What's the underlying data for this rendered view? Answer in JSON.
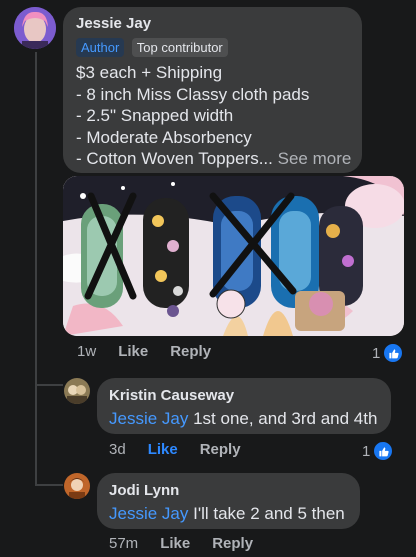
{
  "comments": [
    {
      "author": "Jessie Jay",
      "badges": [
        "Author",
        "Top contributor"
      ],
      "lines": [
        "$3 each + Shipping",
        "- 8 inch Miss Classy cloth pads",
        "- 2.5\" Snapped width",
        "- Moderate Absorbency",
        "- Cotton Woven Toppers..."
      ],
      "see_more": "See more",
      "time": "1w",
      "like_label": "Like",
      "reply_label": "Reply",
      "reaction_count": "1"
    },
    {
      "author": "Kristin Causeway",
      "mention": "Jessie Jay",
      "text": " 1st one, and 3rd and 4th",
      "time": "3d",
      "like_label": "Like",
      "reply_label": "Reply",
      "reaction_count": "1"
    },
    {
      "author": "Jodi Lynn",
      "mention": "Jessie Jay",
      "text": " I'll take 2 and 5 then",
      "time": "57m",
      "like_label": "Like",
      "reply_label": "Reply"
    }
  ],
  "colors": {
    "background": "#18191a",
    "bubble": "#3a3b3c",
    "link": "#4599ff",
    "like_blue": "#1877f2"
  }
}
